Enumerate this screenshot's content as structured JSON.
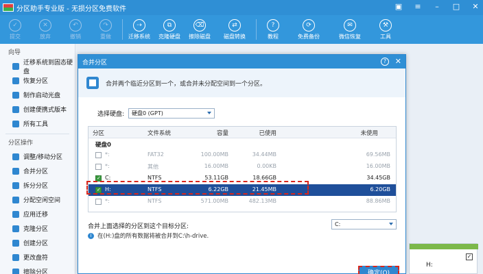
{
  "window": {
    "title": "分区助手专业版 - 无损分区免费软件"
  },
  "toolbar": {
    "items": [
      {
        "label": "提交",
        "icon": "check-icon",
        "disabled": true
      },
      {
        "label": "放弃",
        "icon": "cancel-icon",
        "disabled": true
      },
      {
        "label": "撤销",
        "icon": "undo-icon",
        "disabled": true
      },
      {
        "label": "重做",
        "icon": "redo-icon",
        "disabled": true
      },
      {
        "label": "迁移系统",
        "icon": "migrate-icon"
      },
      {
        "label": "克隆硬盘",
        "icon": "clone-disk-icon"
      },
      {
        "label": "擦除磁盘",
        "icon": "erase-disk-icon"
      },
      {
        "label": "磁盘转换",
        "icon": "convert-disk-icon"
      },
      {
        "label": "教程",
        "icon": "tutorial-icon"
      },
      {
        "label": "免费备份",
        "icon": "backup-icon"
      },
      {
        "label": "微信恢复",
        "icon": "wechat-recover-icon"
      },
      {
        "label": "工具",
        "icon": "tools-icon"
      }
    ]
  },
  "sidebar": {
    "wizard_title": "向导",
    "wizard_items": [
      "迁移系统到固态硬盘",
      "恢复分区",
      "制作启动光盘",
      "创建便携式版本",
      "所有工具"
    ],
    "ops_title": "分区操作",
    "ops_items": [
      "调整/移动分区",
      "合并分区",
      "拆分分区",
      "分配空闲空间",
      "应用迁移",
      "克隆分区",
      "创建分区",
      "更改盘符",
      "擦除分区"
    ]
  },
  "dialog": {
    "title": "合并分区",
    "banner": "合并两个临近分区到一个，或合并未分配空间到一个分区。",
    "disk_label": "选择硬盘:",
    "disk_value": "硬盘0 (GPT)",
    "columns": [
      "分区",
      "文件系统",
      "容量",
      "已使用",
      "未使用"
    ],
    "group": "硬盘0",
    "rows": [
      {
        "name": "*:",
        "fs": "FAT32",
        "cap": "100.00MB",
        "used": "34.44MB",
        "free": "69.56MB",
        "checked": false,
        "dim": true
      },
      {
        "name": "*:",
        "fs": "其他",
        "cap": "16.00MB",
        "used": "0.00KB",
        "free": "16.00MB",
        "checked": false,
        "dim": true
      },
      {
        "name": "C:",
        "fs": "NTFS",
        "cap": "53.11GB",
        "used": "18.66GB",
        "free": "34.45GB",
        "checked": true,
        "dim": false
      },
      {
        "name": "H:",
        "fs": "NTFS",
        "cap": "6.22GB",
        "used": "21.45MB",
        "free": "6.20GB",
        "checked": true,
        "dim": false,
        "selected": true
      },
      {
        "name": "*:",
        "fs": "NTFS",
        "cap": "571.00MB",
        "used": "482.13MB",
        "free": "88.86MB",
        "checked": false,
        "dim": true
      }
    ],
    "merge_label": "合并上面选择的分区到这个目标分区:",
    "target_value": "C:",
    "info": "在(H:)盘的所有数据将被合并到C:\\h-drive.",
    "ok_label": "确定(O)"
  },
  "disk_card": {
    "label": "H:",
    "check": "✓"
  }
}
